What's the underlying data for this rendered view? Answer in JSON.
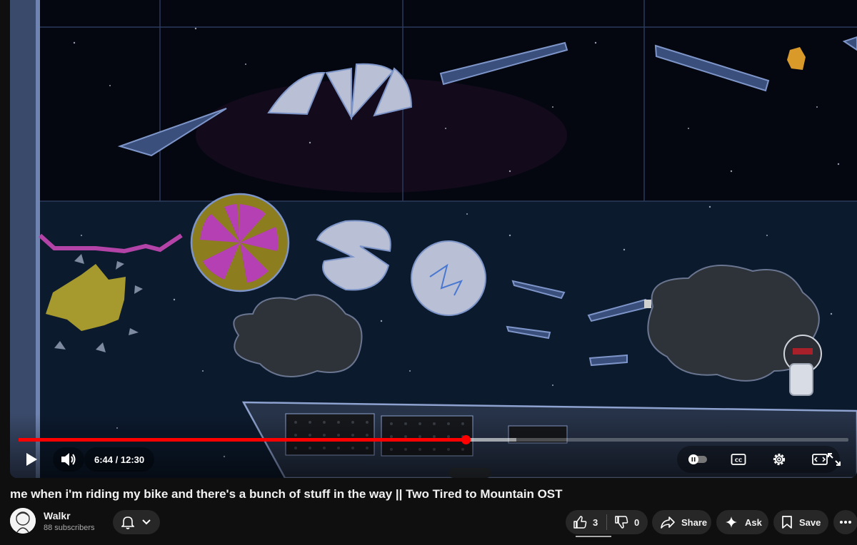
{
  "player": {
    "current_time": "6:44",
    "separator": " / ",
    "duration": "12:30",
    "progress_played_fraction": 0.539,
    "progress_buffered_fraction": 0.6
  },
  "video": {
    "title": "me when i'm riding my bike and there's a bunch of stuff in the way || Two Tired to Mountain OST"
  },
  "channel": {
    "name": "Walkr",
    "subscribers": "88 subscribers"
  },
  "actions": {
    "like_count": "3",
    "dislike_count": "0",
    "share_label": "Share",
    "ask_label": "Ask",
    "save_label": "Save"
  },
  "icons": {
    "play": "play-icon",
    "volume": "volume-icon",
    "autoplay": "autoplay-toggle-icon",
    "captions": "captions-icon",
    "settings": "gear-icon",
    "theater": "theater-mode-icon",
    "fullscreen": "fullscreen-icon",
    "bell": "bell-icon",
    "like": "thumbs-up-icon",
    "dislike": "thumbs-down-icon",
    "share": "share-arrow-icon",
    "ask": "sparkle-icon",
    "save": "bookmark-icon",
    "more": "more-dots-icon"
  },
  "colors": {
    "progress": "#ff0000",
    "page_bg": "#0f0f0f",
    "button_bg": "#272727"
  }
}
